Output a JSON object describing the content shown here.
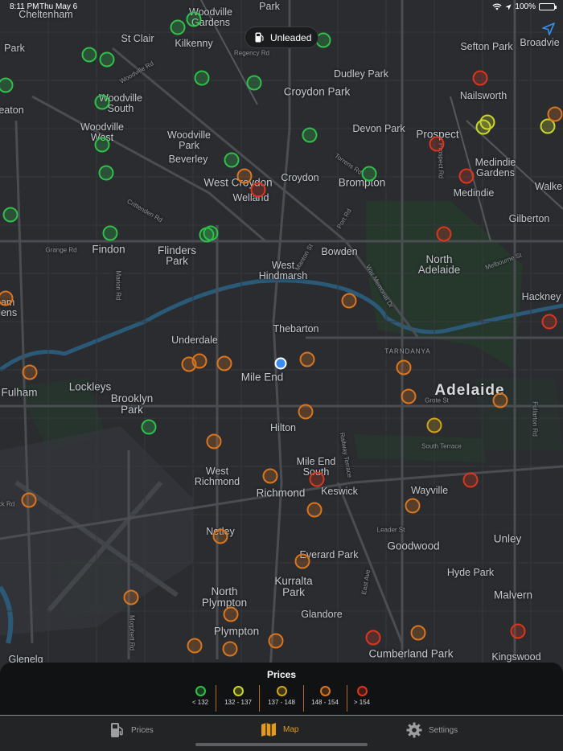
{
  "status": {
    "time": "8:11 PM",
    "date": "Thu May 6",
    "battery": "100%"
  },
  "fuel_selector": {
    "label": "Unleaded"
  },
  "map": {
    "suburbs": [
      {
        "id": "cheltenham",
        "text": "Cheltenham"
      },
      {
        "id": "woodville-gardens",
        "text": "Woodville Gardens"
      },
      {
        "id": "park-top",
        "text": "Park"
      },
      {
        "id": "st-clair",
        "text": "St Clair"
      },
      {
        "id": "kilkenny",
        "text": "Kilkenny"
      },
      {
        "id": "sefton-park",
        "text": "Sefton Park"
      },
      {
        "id": "broadview",
        "text": "Broadvie"
      },
      {
        "id": "park-left",
        "text": "Park"
      },
      {
        "id": "dudley-park",
        "text": "Dudley Park"
      },
      {
        "id": "nailsworth",
        "text": "Nailsworth"
      },
      {
        "id": "croydon-park",
        "text": "Croydon Park"
      },
      {
        "id": "woodville-south",
        "text": "Woodville South"
      },
      {
        "id": "seaton",
        "text": "eaton"
      },
      {
        "id": "woodville-west",
        "text": "Woodville West"
      },
      {
        "id": "devon-park",
        "text": "Devon Park"
      },
      {
        "id": "prospect",
        "text": "Prospect"
      },
      {
        "id": "woodville-park",
        "text": "Woodville Park"
      },
      {
        "id": "beverley",
        "text": "Beverley"
      },
      {
        "id": "medindie-gardens",
        "text": "Medindie Gardens"
      },
      {
        "id": "west-croydon",
        "text": "West Croydon"
      },
      {
        "id": "croydon",
        "text": "Croydon"
      },
      {
        "id": "brompton",
        "text": "Brompton"
      },
      {
        "id": "walkerville",
        "text": "Walke"
      },
      {
        "id": "welland",
        "text": "Welland"
      },
      {
        "id": "medindie",
        "text": "Medindie"
      },
      {
        "id": "gilberton",
        "text": "Gilberton"
      },
      {
        "id": "findon",
        "text": "Findon"
      },
      {
        "id": "flinders-park",
        "text": "Flinders Park"
      },
      {
        "id": "bowden",
        "text": "Bowden"
      },
      {
        "id": "north-adelaide",
        "text": "North Adelaide"
      },
      {
        "id": "west-hindmarsh",
        "text": "West Hindmarsh"
      },
      {
        "id": "hackney",
        "text": "Hackney"
      },
      {
        "id": "henley-gardens",
        "text": "ham dens"
      },
      {
        "id": "thebarton",
        "text": "Thebarton"
      },
      {
        "id": "underdale",
        "text": "Underdale"
      },
      {
        "id": "tarndanya",
        "text": "TARNDANYA"
      },
      {
        "id": "mile-end",
        "text": "Mile End"
      },
      {
        "id": "adelaide",
        "text": "Adelaide"
      },
      {
        "id": "fulham",
        "text": "Fulham"
      },
      {
        "id": "lockleys",
        "text": "Lockleys"
      },
      {
        "id": "brooklyn-park",
        "text": "Brooklyn Park"
      },
      {
        "id": "hilton",
        "text": "Hilton"
      },
      {
        "id": "west-richmond",
        "text": "West Richmond"
      },
      {
        "id": "mile-end-south",
        "text": "Mile End South"
      },
      {
        "id": "richmond",
        "text": "Richmond"
      },
      {
        "id": "keswick",
        "text": "Keswick"
      },
      {
        "id": "wayville",
        "text": "Wayville"
      },
      {
        "id": "unley",
        "text": "Unley"
      },
      {
        "id": "netley",
        "text": "Netley"
      },
      {
        "id": "goodwood",
        "text": "Goodwood"
      },
      {
        "id": "everard-park",
        "text": "Everard Park"
      },
      {
        "id": "hyde-park",
        "text": "Hyde Park"
      },
      {
        "id": "north-plympton",
        "text": "North Plympton"
      },
      {
        "id": "kurralta-park",
        "text": "Kurralta Park"
      },
      {
        "id": "malvern",
        "text": "Malvern"
      },
      {
        "id": "glandore",
        "text": "Glandore"
      },
      {
        "id": "plympton",
        "text": "Plympton"
      },
      {
        "id": "cumberland-park",
        "text": "Cumberland Park"
      },
      {
        "id": "kingswood",
        "text": "Kingswood"
      },
      {
        "id": "glenelg",
        "text": "Glenelg"
      }
    ],
    "streets": [
      {
        "id": "woodville-rd",
        "text": "Woodville Rd"
      },
      {
        "id": "regency-rd",
        "text": "Regency Rd"
      },
      {
        "id": "torrens-rd",
        "text": "Torrens Rd"
      },
      {
        "id": "prospect-rd",
        "text": "Prospect Rd"
      },
      {
        "id": "crittenden-rd",
        "text": "Crittenden Rd"
      },
      {
        "id": "grange-rd",
        "text": "Grange Rd"
      },
      {
        "id": "port-rd",
        "text": "Port Rd"
      },
      {
        "id": "manton-st",
        "text": "Manton St"
      },
      {
        "id": "war-memorial-dr",
        "text": "War Memorial Dr"
      },
      {
        "id": "melbourne-st",
        "text": "Melbourne St"
      },
      {
        "id": "grote-st",
        "text": "Grote St"
      },
      {
        "id": "south-terrace",
        "text": "South Terrace"
      },
      {
        "id": "railway-terrace",
        "text": "Railway Terrace"
      },
      {
        "id": "leader-st",
        "text": "Leader St"
      },
      {
        "id": "east-ave",
        "text": "East Ave"
      },
      {
        "id": "marion-rd",
        "text": "Marion Rd"
      },
      {
        "id": "morphett-rd",
        "text": "Morphett Rd"
      },
      {
        "id": "fullarton-rd",
        "text": "Fullarton Rd"
      },
      {
        "id": "rd-left",
        "text": "ck Rd"
      }
    ]
  },
  "legend": {
    "title": "Prices",
    "items": [
      {
        "label": "< 132",
        "color": "#2fbf4a"
      },
      {
        "label": "132 - 137",
        "color": "#c9d42d"
      },
      {
        "label": "137 - 148",
        "color": "#d1a31d"
      },
      {
        "label": "148 - 154",
        "color": "#d9751f"
      },
      {
        "label": "> 154",
        "color": "#d9361f"
      }
    ]
  },
  "tabs": {
    "prices": "Prices",
    "map": "Map",
    "settings": "Settings"
  },
  "colors": {
    "accent": "#e39a1e",
    "green": "#2fbf4a",
    "yellow": "#c9d42d",
    "amber": "#d1a31d",
    "orange": "#d9751f",
    "red": "#d9361f"
  },
  "icons": {
    "fuel": "fuel-pump-icon",
    "map": "map-icon",
    "settings": "gear-icon",
    "locate": "location-arrow-icon",
    "wifi": "wifi-icon",
    "battery": "battery-icon"
  }
}
